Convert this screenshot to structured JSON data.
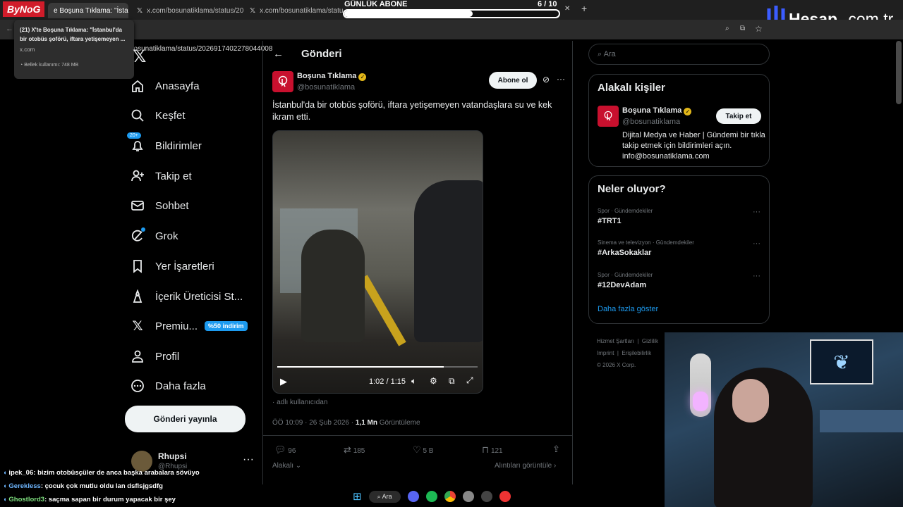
{
  "browser": {
    "tabs": [
      {
        "title": "e Boşuna Tıklama: \"İstan"
      },
      {
        "title": "x.com/bosunatiklama/status/20"
      },
      {
        "title": "x.com/bosunatiklama/status/20"
      }
    ],
    "url": "bosunatiklama/status/2026917402278044008",
    "tooltip": {
      "title": "(21) X'te Boşuna Tıklama: \"İstanbul'da bir otobüs şoförü, iftara yetişemeyen ...",
      "domain": "x.com",
      "memory": "Bellek kullanımı: 748 MB"
    }
  },
  "overlay": {
    "stream_logo": "ByNoG",
    "sub_goal_label": "GÜNLÜK ABONE",
    "sub_goal_count": "6",
    "sub_goal_total": "/ 10",
    "sub_goal_progress": 0.6,
    "sponsor_logo": "Hesap",
    "sponsor_logo_suffix": ".com.tr"
  },
  "nav": {
    "items": [
      {
        "label": "Anasayfa",
        "icon": "home-icon"
      },
      {
        "label": "Keşfet",
        "icon": "search-icon"
      },
      {
        "label": "Bildirimler",
        "icon": "bell-icon",
        "badge": "20+"
      },
      {
        "label": "Takip et",
        "icon": "add-person-icon"
      },
      {
        "label": "Sohbet",
        "icon": "mail-icon"
      },
      {
        "label": "Grok",
        "icon": "grok-icon"
      },
      {
        "label": "Yer İşaretleri",
        "icon": "bookmark-icon"
      },
      {
        "label": "İçerik Üreticisi St...",
        "icon": "creator-icon"
      },
      {
        "label": "Premiu...",
        "icon": "x-logo-icon",
        "badge": "%50 indirim"
      },
      {
        "label": "Profil",
        "icon": "person-icon"
      },
      {
        "label": "Daha fazla",
        "icon": "more-icon"
      }
    ],
    "post_button": "Gönderi yayınla",
    "account_name": "Rhupsi",
    "account_handle": "@Rhupsi"
  },
  "post": {
    "header": "Gönderi",
    "author_name": "Boşuna Tıklama",
    "author_handle": "@bosunatiklama",
    "subscribe": "Abone ol",
    "text": "İstanbul'da bir otobüs şoförü, iftara yetişemeyen vatandaşlara su ve kek ikram etti.",
    "video_time": "1:02 / 1:15",
    "video_progress": 0.83,
    "source": "adlı kullanıcıdan",
    "time": "ÖÖ 10:09 · 26 Şub 2026 · ",
    "views": "1,1 Mn",
    "views_label": "Görüntüleme",
    "replies": "96",
    "reposts": "185",
    "likes": "5 B",
    "bookmarks": "121",
    "related": "Alakalı",
    "quotes": "Alıntıları görüntüle"
  },
  "sidebar": {
    "search_placeholder": "Ara",
    "related_title": "Alakalı kişiler",
    "related_name": "Boşuna Tıklama",
    "related_handle": "@bosunatiklama",
    "follow": "Takip et",
    "bio": "Dijital Medya ve Haber | Gündemi bir tıkla takip etmek için bildirimleri açın. info@bosunatiklama.com",
    "trends_title": "Neler oluyor?",
    "trends": [
      {
        "meta": "Spor · Gündemdekiler",
        "tag": "#TRT1"
      },
      {
        "meta": "Sinema ve televizyon · Gündemdekiler",
        "tag": "#ArkaSokaklar"
      },
      {
        "meta": "Spor · Gündemdekiler",
        "tag": "#12DevAdam"
      }
    ],
    "show_more": "Daha fazla göster",
    "footer_1": "Hizmet Şartları",
    "footer_2": "Gizlilik",
    "footer_3": "Imprint",
    "footer_4": "Erişilebilirlik",
    "footer_copy": "© 2026 X Corp."
  },
  "chat": [
    {
      "user": "ipek_06",
      "color": "#ffffff",
      "msg": ": bizim otobüsçüler de anca başka arabalara sövüyo"
    },
    {
      "user": "Gerekless",
      "color": "#6fb7ff",
      "msg": ": çocuk çok mutlu oldu lan dsflsjgsdfg"
    },
    {
      "user": "Ghostlord3",
      "color": "#7fe07f",
      "msg": ": saçma sapan bir durum yapacak bir şey"
    }
  ],
  "taskbar": {
    "search": "Ara"
  },
  "colors": {
    "accent": "#1d9bf0",
    "verified": "#e2b719",
    "brand_red": "#c8102e"
  }
}
